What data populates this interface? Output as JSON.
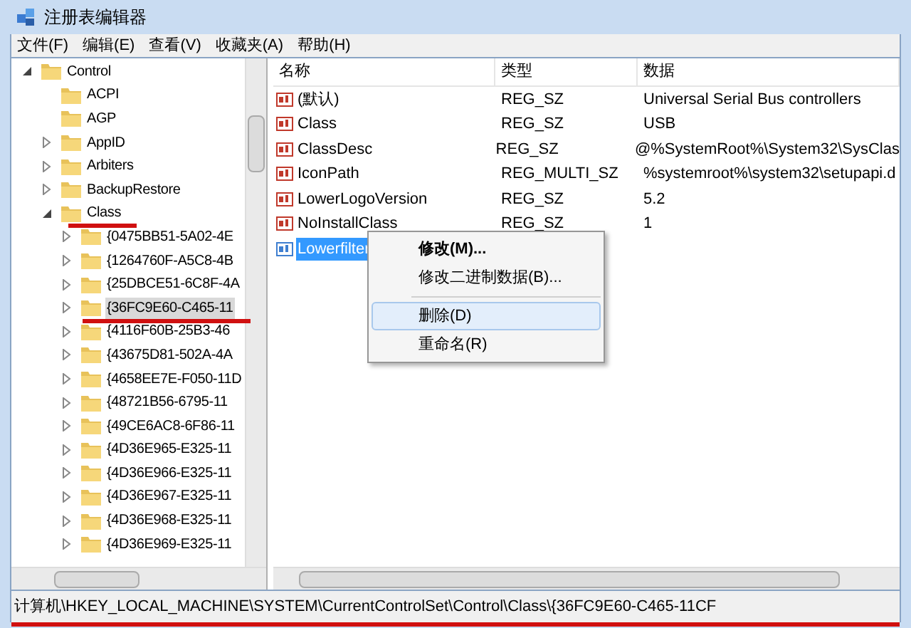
{
  "window": {
    "title": "注册表编辑器"
  },
  "menu": [
    "文件(F)",
    "编辑(E)",
    "查看(V)",
    "收藏夹(A)",
    "帮助(H)"
  ],
  "tree": [
    {
      "label": "Control",
      "expanded": true,
      "selected": false,
      "children": [
        {
          "label": "ACPI",
          "selected": false
        },
        {
          "label": "AGP",
          "selected": false
        },
        {
          "label": "AppID",
          "expanded": false,
          "selected": false
        },
        {
          "label": "Arbiters",
          "expanded": false,
          "selected": false
        },
        {
          "label": "BackupRestore",
          "expanded": false,
          "selected": false
        },
        {
          "label": "Class",
          "expanded": true,
          "selected": false,
          "children": [
            {
              "label": "{0475BB51-5A02-4E",
              "expanded": false,
              "selected": false
            },
            {
              "label": "{1264760F-A5C8-4B",
              "expanded": false,
              "selected": false
            },
            {
              "label": "{25DBCE51-6C8F-4A",
              "expanded": false,
              "selected": false
            },
            {
              "label": "{36FC9E60-C465-11",
              "expanded": false,
              "selected": true
            },
            {
              "label": "{4116F60B-25B3-46",
              "expanded": false,
              "selected": false
            },
            {
              "label": "{43675D81-502A-4A",
              "expanded": false,
              "selected": false
            },
            {
              "label": "{4658EE7E-F050-11D",
              "expanded": false,
              "selected": false
            },
            {
              "label": "{48721B56-6795-11",
              "expanded": false,
              "selected": false
            },
            {
              "label": "{49CE6AC8-6F86-11",
              "expanded": false,
              "selected": false
            },
            {
              "label": "{4D36E965-E325-11",
              "expanded": false,
              "selected": false
            },
            {
              "label": "{4D36E966-E325-11",
              "expanded": false,
              "selected": false
            },
            {
              "label": "{4D36E967-E325-11",
              "expanded": false,
              "selected": false
            },
            {
              "label": "{4D36E968-E325-11",
              "expanded": false,
              "selected": false
            },
            {
              "label": "{4D36E969-E325-11",
              "expanded": false,
              "selected": false
            }
          ]
        }
      ]
    }
  ],
  "values": {
    "columns": [
      "名称",
      "类型",
      "数据"
    ],
    "rows": [
      {
        "name": "(默认)",
        "type": "REG_SZ",
        "data": "Universal Serial Bus controllers",
        "selected": false
      },
      {
        "name": "Class",
        "type": "REG_SZ",
        "data": "USB",
        "selected": false
      },
      {
        "name": "ClassDesc",
        "type": "REG_SZ",
        "data": "@%SystemRoot%\\System32\\SysClas",
        "selected": false
      },
      {
        "name": "IconPath",
        "type": "REG_MULTI_SZ",
        "data": "%systemroot%\\system32\\setupapi.d",
        "selected": false
      },
      {
        "name": "LowerLogoVersion",
        "type": "REG_SZ",
        "data": "5.2",
        "selected": false
      },
      {
        "name": "NoInstallClass",
        "type": "REG_SZ",
        "data": "1",
        "selected": false
      },
      {
        "name": "Lowerfilter",
        "selected": true
      }
    ]
  },
  "context_menu": {
    "items": [
      {
        "kind": "item",
        "label": "修改(M)...",
        "default": true,
        "selected": false
      },
      {
        "kind": "item",
        "label": "修改二进制数据(B)...",
        "default": false,
        "selected": false
      },
      {
        "kind": "separator"
      },
      {
        "kind": "item",
        "label": "删除(D)",
        "default": false,
        "selected": true
      },
      {
        "kind": "item",
        "label": "重命名(R)",
        "default": false,
        "selected": false
      }
    ]
  },
  "status_bar": "计算机\\HKEY_LOCAL_MACHINE\\SYSTEM\\CurrentControlSet\\Control\\Class\\{36FC9E60-C465-11CF"
}
